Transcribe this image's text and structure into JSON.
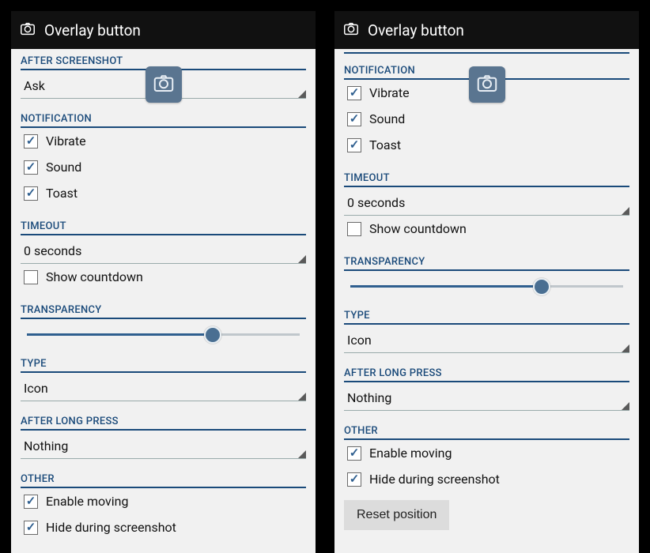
{
  "colors": {
    "accent": "#1a4a7a",
    "thumb": "#4a6f92"
  },
  "titlebar": {
    "title": "Overlay button",
    "icon": "camera-icon"
  },
  "overlay_badge_icon": "camera-icon",
  "left": {
    "sections": {
      "after_screenshot": {
        "header": "AFTER SCREENSHOT",
        "value": "Ask"
      },
      "notification": {
        "header": "NOTIFICATION",
        "items": [
          {
            "label": "Vibrate",
            "checked": true
          },
          {
            "label": "Sound",
            "checked": true
          },
          {
            "label": "Toast",
            "checked": true
          }
        ]
      },
      "timeout": {
        "header": "TIMEOUT",
        "value": "0 seconds",
        "countdown": {
          "label": "Show countdown",
          "checked": false
        }
      },
      "transparency": {
        "header": "TRANSPARENCY",
        "value_percent": 68
      },
      "type": {
        "header": "TYPE",
        "value": "Icon"
      },
      "after_long_press": {
        "header": "AFTER LONG PRESS",
        "value": "Nothing"
      },
      "other": {
        "header": "OTHER",
        "items": [
          {
            "label": "Enable moving",
            "checked": true
          },
          {
            "label": "Hide during screenshot",
            "checked": true
          }
        ]
      }
    }
  },
  "right": {
    "sections": {
      "notification": {
        "header": "NOTIFICATION",
        "items": [
          {
            "label": "Vibrate",
            "checked": true
          },
          {
            "label": "Sound",
            "checked": true
          },
          {
            "label": "Toast",
            "checked": true
          }
        ]
      },
      "timeout": {
        "header": "TIMEOUT",
        "value": "0 seconds",
        "countdown": {
          "label": "Show countdown",
          "checked": false
        }
      },
      "transparency": {
        "header": "TRANSPARENCY",
        "value_percent": 70
      },
      "type": {
        "header": "TYPE",
        "value": "Icon"
      },
      "after_long_press": {
        "header": "AFTER LONG PRESS",
        "value": "Nothing"
      },
      "other": {
        "header": "OTHER",
        "items": [
          {
            "label": "Enable moving",
            "checked": true
          },
          {
            "label": "Hide during screenshot",
            "checked": true
          }
        ],
        "reset_label": "Reset position"
      }
    }
  }
}
